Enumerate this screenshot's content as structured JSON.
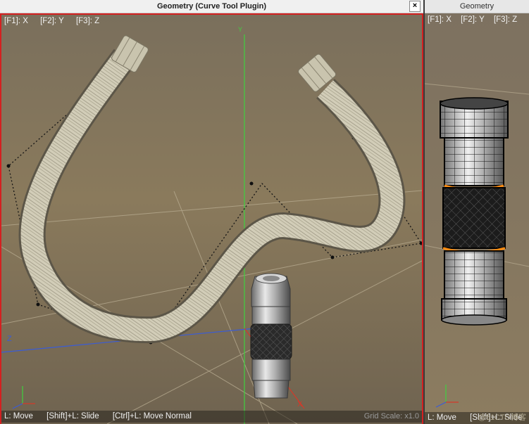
{
  "main_window": {
    "title": "Geometry (Curve Tool Plugin)",
    "close_icon": "×",
    "axis_hints": [
      "[F1]: X",
      "[F2]: Y",
      "[F3]: Z"
    ],
    "status": [
      "L: Move",
      "[Shift]+L: Slide",
      "[Ctrl]+L: Move Normal"
    ],
    "grid_scale": "Grid Scale: x1.0",
    "axis_labels": {
      "y": "Y",
      "z": "Z",
      "x": "X"
    }
  },
  "side_window": {
    "title": "Geometry",
    "axis_hints": [
      "[F1]: X",
      "[F2]: Y",
      "[F3]: Z"
    ],
    "status": [
      "L: Move",
      "[Shift]+L: Slide"
    ],
    "watermark": "@51CTO博客"
  },
  "colors": {
    "viewport_bg": "#8a7a5c",
    "accent_border": "#d42020",
    "hose": "#cfcab5",
    "wire_orange": "#ff8c10"
  }
}
